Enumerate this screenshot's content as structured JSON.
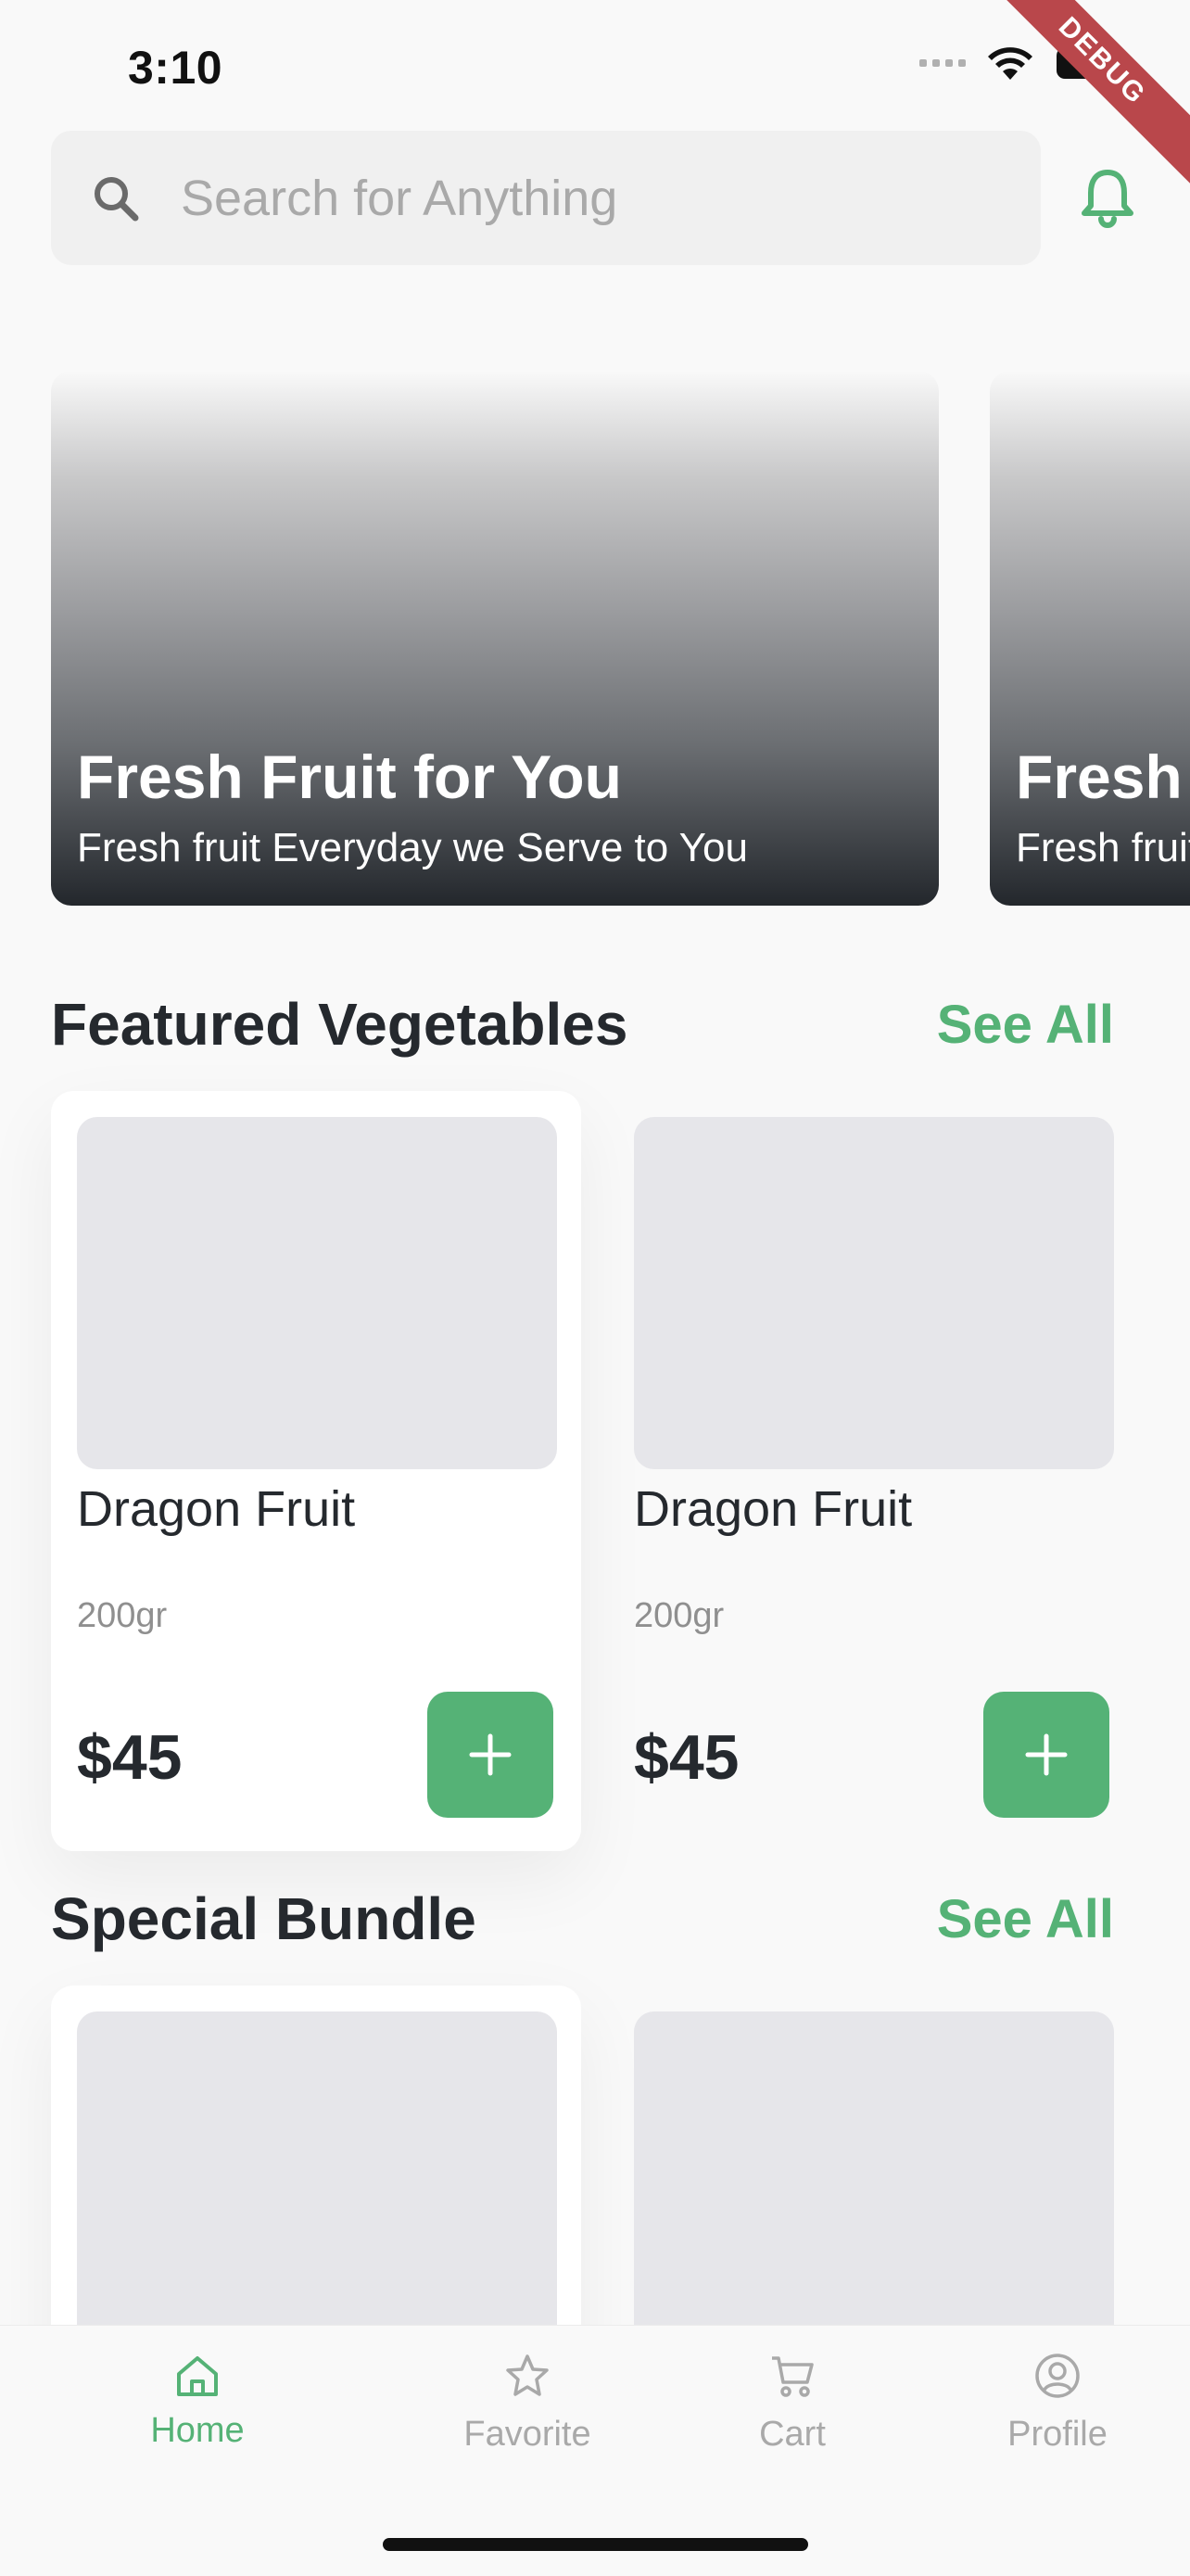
{
  "status_bar": {
    "time": "3:10",
    "debug_label": "DEBUG"
  },
  "search": {
    "placeholder": "Search for Anything",
    "value": ""
  },
  "banners": [
    {
      "title": "Fresh Fruit for You",
      "subtitle": "Fresh fruit Everyday we Serve to You"
    },
    {
      "title": "Fresh Fruit for You",
      "subtitle": "Fresh fruit Everyday we Serve to You"
    }
  ],
  "featured": {
    "title": "Featured Vegetables",
    "see_all": "See All",
    "products": [
      {
        "name": "Dragon Fruit",
        "weight": "200gr",
        "price": "$45"
      },
      {
        "name": "Dragon Fruit",
        "weight": "200gr",
        "price": "$45"
      }
    ]
  },
  "bundle": {
    "title": "Special Bundle",
    "see_all": "See All"
  },
  "bottom_nav": {
    "items": [
      {
        "label": "Home",
        "icon": "home-icon",
        "active": true
      },
      {
        "label": "Favorite",
        "icon": "star-icon",
        "active": false
      },
      {
        "label": "Cart",
        "icon": "cart-icon",
        "active": false
      },
      {
        "label": "Profile",
        "icon": "profile-icon",
        "active": false
      }
    ]
  },
  "colors": {
    "accent": "#55b276",
    "text": "#25292e",
    "muted": "#a9a9a9",
    "placeholder_image": "#e6e6ea",
    "debug_ribbon": "#b9474b"
  }
}
